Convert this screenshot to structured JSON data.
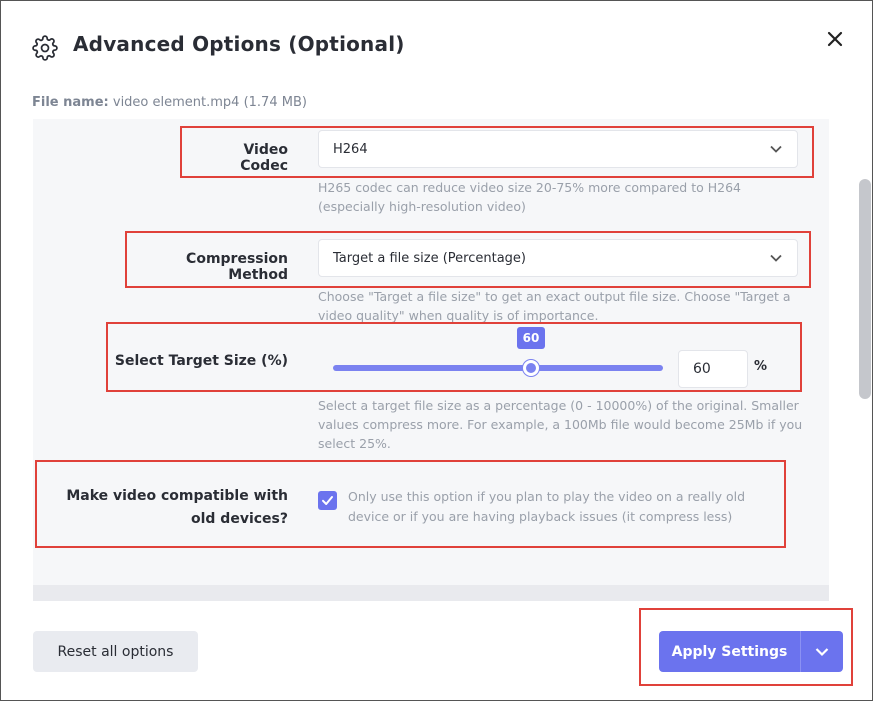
{
  "header": {
    "title": "Advanced Options (Optional)",
    "icon": "gear-icon",
    "close_icon": "close-icon"
  },
  "file": {
    "label": "File name:",
    "value": "video element.mp4 (1.74 MB)"
  },
  "codec": {
    "label": "Video Codec",
    "selected": "H264",
    "help": "H265 codec can reduce video size 20-75% more compared to H264 (especially high-resolution video)"
  },
  "compression": {
    "label": "Compression Method",
    "selected": "Target a file size (Percentage)",
    "help": "Choose \"Target a file size\" to get an exact output file size. Choose \"Target a video quality\" when quality is of importance."
  },
  "target_size": {
    "label": "Select Target Size (%)",
    "slider_value": "60",
    "slider_fraction": 0.6,
    "input_value": "60",
    "unit": "%",
    "help": "Select a target file size as a percentage (0 - 10000%) of the original. Smaller values compress more. For example, a 100Mb file would become 25Mb if you select 25%."
  },
  "compat": {
    "label_line1": "Make video compatible with",
    "label_line2": "old devices?",
    "checked": true,
    "text": "Only use this option if you plan to play the video on a really old device or if you are having playback issues (it compress less)"
  },
  "footer": {
    "reset_label": "Reset all options",
    "apply_label": "Apply Settings"
  },
  "colors": {
    "accent": "#6b73ee",
    "highlight": "#e0413a",
    "panel": "#f6f7f9"
  }
}
